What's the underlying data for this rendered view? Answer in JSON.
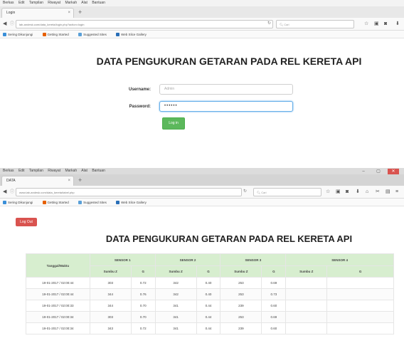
{
  "panel1": {
    "menu": [
      "Berkas",
      "Edit",
      "Tampilan",
      "Riwayat",
      "Markah",
      "Alat",
      "Bantuan"
    ],
    "tab_title": "Login",
    "tab_close": "×",
    "new_tab": "+",
    "url": "lab-andesk.com/data_kereta/login.php?action=login",
    "search_placeholder": "Cari",
    "bookmarks": [
      "Sering Dikunjungi",
      "Getting Started",
      "Suggested Sites",
      "Web Slice Gallery"
    ],
    "heading": "DATA PENGUKURAN GETARAN PADA REL KERETA API",
    "username_label": "Username:",
    "username_placeholder": "Admin",
    "password_label": "Password:",
    "password_value": "••••••",
    "login_button": "Log in"
  },
  "panel2": {
    "menu": [
      "Berkas",
      "Edit",
      "Tampilan",
      "Riwayat",
      "Markah",
      "Alat",
      "Bantuan"
    ],
    "tab_title": "DATA",
    "tab_close": "×",
    "new_tab": "+",
    "url": "www.lab-andesk.com/data_kereta/tabel.php",
    "search_placeholder": "Cari",
    "bookmarks": [
      "Sering Dikunjungi",
      "Getting Started",
      "Suggested Sites",
      "Web Slice Gallery"
    ],
    "logout_button": "Log Out",
    "heading": "DATA PENGUKURAN GETARAN PADA REL KERETA API",
    "table": {
      "date_header": "Tanggal/Waktu",
      "sensor_headers": [
        "SENSOR 1",
        "SENSOR 2",
        "SENSOR 3",
        "SENSOR 4"
      ],
      "sub_headers": [
        "Sumbu Z",
        "G",
        "Sumbu Z",
        "G",
        "Sumbu Z",
        "G",
        "Sumbu Z",
        "G"
      ],
      "rows": [
        [
          "19-01-2017 / 02:00:44",
          "303",
          "0.72",
          "342",
          "0.40",
          "253",
          "0.69",
          "",
          ""
        ],
        [
          "19-01-2017 / 02:00:44",
          "344",
          "0.76",
          "342",
          "0.40",
          "253",
          "0.73",
          "",
          ""
        ],
        [
          "19-01-2017 / 02:00:33",
          "344",
          "0.70",
          "341",
          "0.44",
          "239",
          "0.60",
          "",
          ""
        ],
        [
          "19-01-2017 / 02:00:34",
          "303",
          "0.70",
          "341",
          "0.44",
          "253",
          "0.69",
          "",
          ""
        ],
        [
          "19-01-2017 / 02:00:34",
          "343",
          "0.72",
          "341",
          "0.44",
          "239",
          "0.60",
          "",
          ""
        ]
      ]
    }
  }
}
